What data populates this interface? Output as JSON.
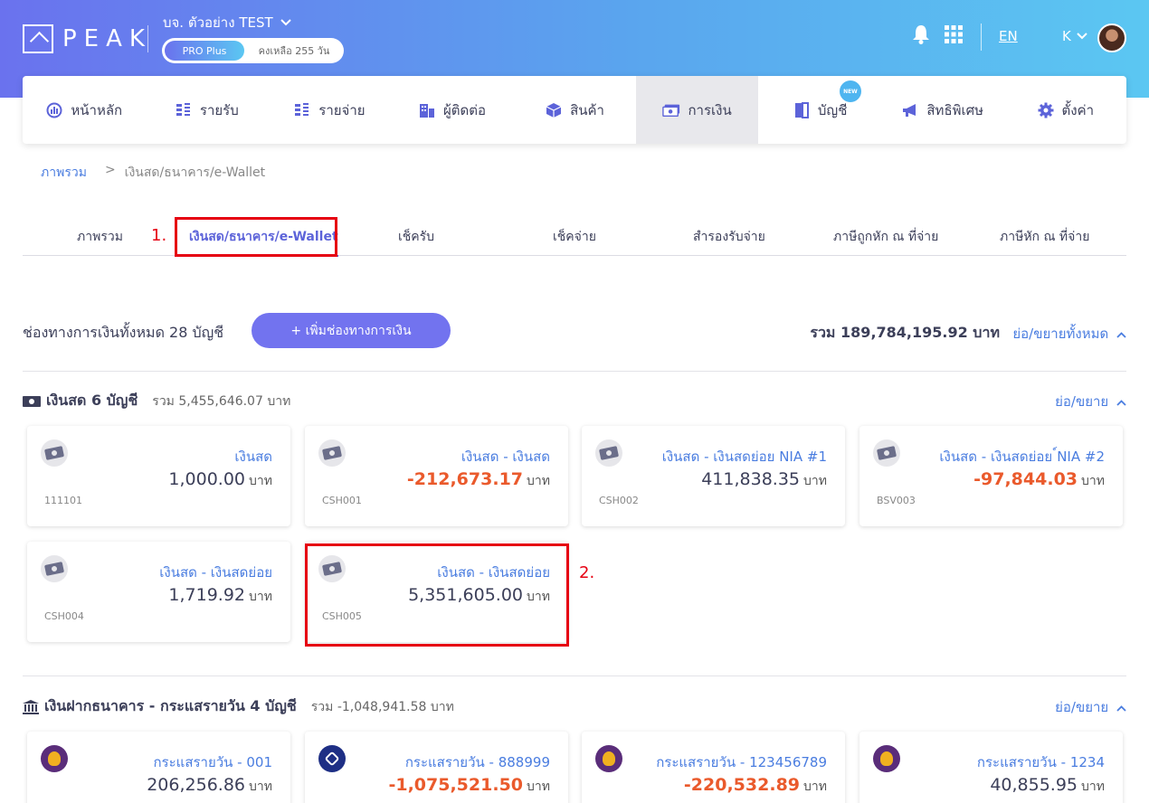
{
  "header": {
    "logo_text": "PEAK",
    "company": "บจ. ตัวอย่าง TEST",
    "plan": "PRO Plus",
    "remaining": "คงเหลือ 255 วัน",
    "lang": "EN",
    "user_initial": "K"
  },
  "nav": [
    {
      "label": "หน้าหลัก",
      "icon": "dashboard-icon"
    },
    {
      "label": "รายรับ",
      "icon": "income-icon"
    },
    {
      "label": "รายจ่าย",
      "icon": "expense-icon"
    },
    {
      "label": "ผู้ติดต่อ",
      "icon": "contacts-icon"
    },
    {
      "label": "สินค้า",
      "icon": "product-box-icon"
    },
    {
      "label": "การเงิน",
      "icon": "finance-money-icon",
      "active": true
    },
    {
      "label": "บัญชี",
      "icon": "book-icon",
      "badge": "NEW"
    },
    {
      "label": "สิทธิพิเศษ",
      "icon": "megaphone-icon"
    },
    {
      "label": "ตั้งค่า",
      "icon": "gear-icon"
    }
  ],
  "breadcrumb": {
    "root": "ภาพรวม",
    "separator": ">",
    "current": "เงินสด/ธนาคาร/e-Wallet"
  },
  "subtabs": [
    {
      "label": "ภาพรวม"
    },
    {
      "label": "เงินสด/ธนาคาร/e-Wallet",
      "active": true
    },
    {
      "label": "เช็ครับ"
    },
    {
      "label": "เช็คจ่าย"
    },
    {
      "label": "สำรองรับจ่าย"
    },
    {
      "label": "ภาษีถูกหัก ณ ที่จ่าย"
    },
    {
      "label": "ภาษีหัก ณ ที่จ่าย"
    }
  ],
  "annotations": {
    "step1": "1.",
    "step2": "2."
  },
  "summary": {
    "title": "ช่องทางการเงินทั้งหมด 28 บัญชี",
    "add_button": "+ เพิ่มช่องทางการเงิน",
    "total": "รวม 189,784,195.92 บาท",
    "collapse_all": "ย่อ/ขยายทั้งหมด"
  },
  "cash_section": {
    "title": "เงินสด 6 บัญชี",
    "sum": "รวม 5,455,646.07 บาท",
    "toggle": "ย่อ/ขยาย",
    "cards": [
      {
        "name": "เงินสด",
        "amount": "1,000.00",
        "unit": "บาท",
        "code": "111101",
        "negative": false
      },
      {
        "name": "เงินสด - เงินสด",
        "amount": "-212,673.17",
        "unit": "บาท",
        "code": "CSH001",
        "negative": true
      },
      {
        "name": "เงินสด - เงินสดย่อย NIA #1",
        "amount": "411,838.35",
        "unit": "บาท",
        "code": "CSH002",
        "negative": false
      },
      {
        "name": "เงินสด - เงินสดย่อย ์NIA #2",
        "amount": "-97,844.03",
        "unit": "บาท",
        "code": "BSV003",
        "negative": true
      },
      {
        "name": "เงินสด - เงินสดย่อย",
        "amount": "1,719.92",
        "unit": "บาท",
        "code": "CSH004",
        "negative": false
      },
      {
        "name": "เงินสด - เงินสดย่อย",
        "amount": "5,351,605.00",
        "unit": "บาท",
        "code": "CSH005",
        "negative": false
      }
    ]
  },
  "bank_section": {
    "title": "เงินฝากธนาคาร - กระแสรายวัน 4 บัญชี",
    "sum": "รวม -1,048,941.58 บาท",
    "toggle": "ย่อ/ขยาย",
    "cards": [
      {
        "name": "กระแสรายวัน - 001",
        "amount": "206,256.86",
        "unit": "บาท",
        "negative": false,
        "bank_color": "#5a2d7a"
      },
      {
        "name": "กระแสรายวัน - 888999",
        "amount": "-1,075,521.50",
        "unit": "บาท",
        "negative": true,
        "bank_color": "#1e2f85"
      },
      {
        "name": "กระแสรายวัน - 123456789",
        "amount": "-220,532.89",
        "unit": "บาท",
        "negative": true,
        "bank_color": "#5a2d7a"
      },
      {
        "name": "กระแสรายวัน - 1234",
        "amount": "40,855.95",
        "unit": "บาท",
        "negative": false,
        "bank_color": "#5a2d7a"
      }
    ]
  },
  "colors": {
    "accent": "#5c63d9",
    "link": "#4a7de0",
    "negative": "#ea5a2c",
    "highlight_box": "#e60012"
  }
}
